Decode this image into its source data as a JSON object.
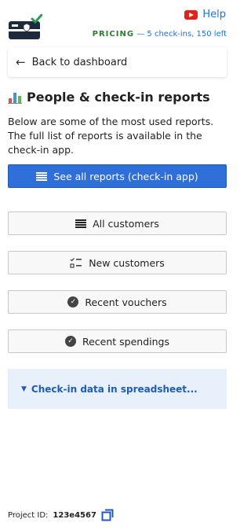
{
  "header": {
    "help_label": "Help",
    "pricing_label": "PRICING",
    "pricing_detail": "— 5 check-ins, 150 left"
  },
  "nav": {
    "back_label": "Back to dashboard"
  },
  "main": {
    "title": "People & check-in reports",
    "description": "Below are some of the most used reports. The full list of reports is available in the check-in app.",
    "primary_button_label": "See all reports (check-in app)",
    "reports": [
      {
        "label": "All customers",
        "icon": "list-icon"
      },
      {
        "label": "New customers",
        "icon": "checklist-icon"
      },
      {
        "label": "Recent vouchers",
        "icon": "check-circle-icon"
      },
      {
        "label": "Recent spendings",
        "icon": "check-circle-icon"
      }
    ],
    "collapsible_label": "Check-in data in spreadsheet..."
  },
  "footer": {
    "project_label": "Project ID:",
    "project_id": "123e4567"
  },
  "colors": {
    "primary": "#2e6fd9",
    "pricing_green": "#2e7d32",
    "link_blue": "#1a73e8",
    "collapsible_bg": "#e8f0fb"
  }
}
